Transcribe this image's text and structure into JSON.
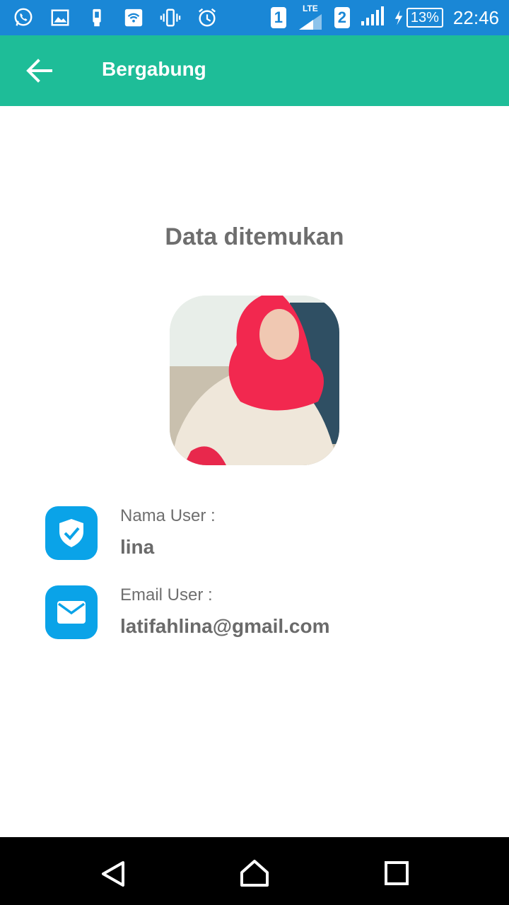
{
  "status_bar": {
    "sim1": "1",
    "sim2": "2",
    "network_type": "LTE",
    "battery": "13%",
    "time": "22:46",
    "icons": [
      "whatsapp-icon",
      "gallery-icon",
      "device-icon",
      "wifi-icon",
      "vibrate-icon",
      "alarm-icon",
      "signal-icon",
      "charging-icon"
    ]
  },
  "app_bar": {
    "title": "Bergabung"
  },
  "main": {
    "heading": "Data ditemukan",
    "user_name_label": "Nama User :",
    "user_name_value": "lina",
    "email_label": "Email User :",
    "email_value": "latifahlina@gmail.com"
  },
  "colors": {
    "status_bar": "#1a87d6",
    "app_bar": "#1ebd98",
    "info_icon_bg": "#0aa3e8",
    "text_gray": "#6e6e6e"
  }
}
